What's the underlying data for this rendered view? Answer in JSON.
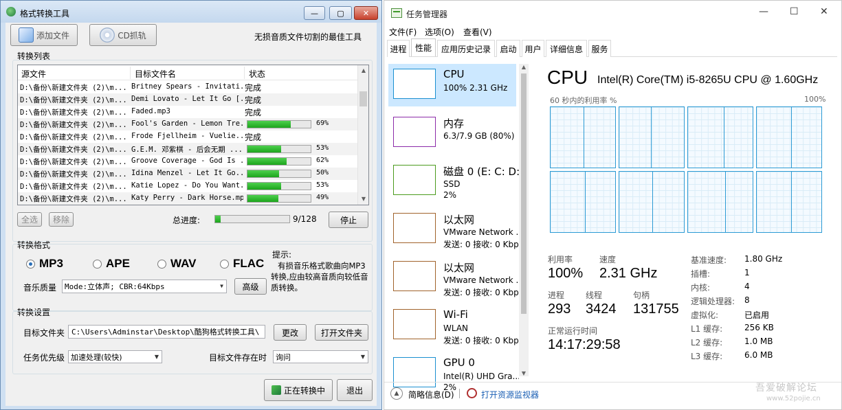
{
  "converter": {
    "title": "格式转换工具",
    "window_controls": {
      "min": "—",
      "max": "▢",
      "close": "✕"
    },
    "add_file": "添加文件",
    "cd_rip": "CD抓轨",
    "slogan": "无损音质文件切割的最佳工具",
    "list_title": "转换列表",
    "columns": [
      "源文件",
      "目标文件名",
      "状态"
    ],
    "rows": [
      {
        "src": "D:\\备份\\新建文件夹 (2)\\m...",
        "dst": "Britney Spears - Invitati...",
        "status": "完成",
        "progress": null
      },
      {
        "src": "D:\\备份\\新建文件夹 (2)\\m...",
        "dst": "Demi Lovato - Let It Go [...",
        "status": "完成",
        "progress": null
      },
      {
        "src": "D:\\备份\\新建文件夹 (2)\\m...",
        "dst": "Faded.mp3",
        "status": "完成",
        "progress": null
      },
      {
        "src": "D:\\备份\\新建文件夹 (2)\\m...",
        "dst": "Fool's Garden - Lemon Tre...",
        "status": "69%",
        "progress": 0.69
      },
      {
        "src": "D:\\备份\\新建文件夹 (2)\\m...",
        "dst": "Frode Fjellheim - Vuelie...",
        "status": "完成",
        "progress": null
      },
      {
        "src": "D:\\备份\\新建文件夹 (2)\\m...",
        "dst": "G.E.M. 邓紫棋 - 后会无期 ...",
        "status": "53%",
        "progress": 0.53
      },
      {
        "src": "D:\\备份\\新建文件夹 (2)\\m...",
        "dst": "Groove Coverage - God Is ...",
        "status": "62%",
        "progress": 0.62
      },
      {
        "src": "D:\\备份\\新建文件夹 (2)\\m...",
        "dst": "Idina Menzel - Let It Go...",
        "status": "50%",
        "progress": 0.5
      },
      {
        "src": "D:\\备份\\新建文件夹 (2)\\m...",
        "dst": "Katie Lopez - Do You Want...",
        "status": "53%",
        "progress": 0.53
      },
      {
        "src": "D:\\备份\\新建文件夹 (2)\\m...",
        "dst": "Katy Perry - Dark Horse.mp3",
        "status": "49%",
        "progress": 0.49
      }
    ],
    "select_all": "全选",
    "remove": "移除",
    "total_label": "总进度:",
    "total_progress": 0.07,
    "total_count": "9/128",
    "stop": "停止",
    "format_title": "转换格式",
    "formats": [
      "MP3",
      "APE",
      "WAV",
      "FLAC"
    ],
    "selected_format": "MP3",
    "hint_title": "提示:",
    "hint_text": "有损音乐格式歌曲向MP3转换,应由较高音质向较低音质转换。",
    "quality_label": "音乐质量",
    "quality_value": "Mode:立体声; CBR:64Kbps",
    "advanced": "高级",
    "settings_title": "转换设置",
    "target_folder_label": "目标文件夹",
    "target_folder": "C:\\Users\\Adminstar\\Desktop\\酷狗格式转换工具\\",
    "change": "更改",
    "open_folder": "打开文件夹",
    "priority_label": "任务优先级",
    "priority_value": "加速处理(较快)",
    "exists_label": "目标文件存在时",
    "exists_value": "询问",
    "converting": "正在转换中",
    "exit": "退出"
  },
  "taskmgr": {
    "title": "任务管理器",
    "controls": {
      "min": "—",
      "max": "☐",
      "close": "✕"
    },
    "menu": [
      "文件(F)",
      "选项(O)",
      "查看(V)"
    ],
    "tabs": [
      "进程",
      "性能",
      "应用历史记录",
      "启动",
      "用户",
      "详细信息",
      "服务"
    ],
    "active_tab": "性能",
    "sidebar": [
      {
        "name": "CPU",
        "l1": "100% 2.31 GHz",
        "l2": "",
        "color": "#1a8fd0"
      },
      {
        "name": "内存",
        "l1": "6.3/7.9 GB (80%)",
        "l2": "",
        "color": "#8b2aa8"
      },
      {
        "name": "磁盘 0 (E: C: D:",
        "l1": "SSD",
        "l2": "2%",
        "color": "#4a9a1c"
      },
      {
        "name": "以太网",
        "l1": "VMware Network ...",
        "l2": "发送: 0 接收: 0 Kbps",
        "color": "#a0622a"
      },
      {
        "name": "以太网",
        "l1": "VMware Network ...",
        "l2": "发送: 0 接收: 0 Kbps",
        "color": "#a0622a"
      },
      {
        "name": "Wi-Fi",
        "l1": "WLAN",
        "l2": "发送: 0 接收: 0 Kbps",
        "color": "#a0622a"
      },
      {
        "name": "GPU 0",
        "l1": "Intel(R) UHD Gra...",
        "l2": "2%",
        "color": "#1a8fd0"
      }
    ],
    "heading": "CPU",
    "model": "Intel(R) Core(TM) i5-8265U CPU @ 1.60GHz",
    "graph_left_label": "60 秒内的利用率 %",
    "graph_right_label": "100%",
    "stats": {
      "util_label": "利用率",
      "util": "100%",
      "speed_label": "速度",
      "speed": "2.31 GHz",
      "proc_label": "进程",
      "proc": "293",
      "thread_label": "线程",
      "thread": "3424",
      "handle_label": "句柄",
      "handle": "131755",
      "uptime_label": "正常运行时间",
      "uptime": "14:17:29:58"
    },
    "specs": [
      {
        "k": "基准速度:",
        "v": "1.80 GHz"
      },
      {
        "k": "插槽:",
        "v": "1"
      },
      {
        "k": "内核:",
        "v": "4"
      },
      {
        "k": "逻辑处理器:",
        "v": "8"
      },
      {
        "k": "虚拟化:",
        "v": "已启用"
      },
      {
        "k": "L1 缓存:",
        "v": "256 KB"
      },
      {
        "k": "L2 缓存:",
        "v": "1.0 MB"
      },
      {
        "k": "L3 缓存:",
        "v": "6.0 MB"
      }
    ],
    "fewer_details": "简略信息(D)",
    "resource_monitor": "打开资源监视器",
    "watermark": "吾爱破解论坛",
    "watermark_url": "www.52pojie.cn"
  }
}
